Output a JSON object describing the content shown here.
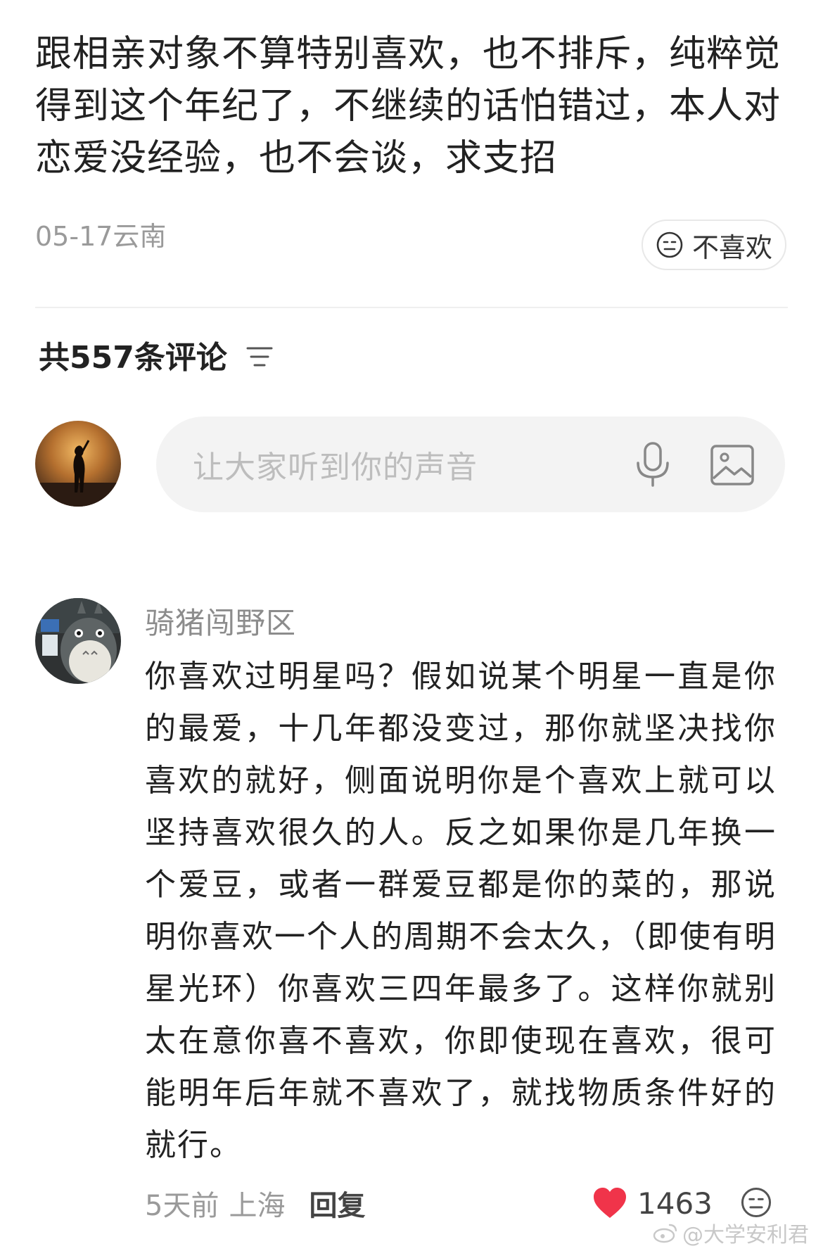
{
  "post": {
    "text": "跟相亲对象不算特别喜欢，也不排斥，纯粹觉得到这个年纪了，不继续的话怕错过，本人对恋爱没经验，也不会谈，求支招",
    "meta": "05-17云南",
    "dislike_label": "不喜欢"
  },
  "comments_section": {
    "header": "共557条评论",
    "input_placeholder": "让大家听到你的声音"
  },
  "comment": {
    "author": "骑猪闯野区",
    "body": "你喜欢过明星吗？假如说某个明星一直是你的最爱，十几年都没变过，那你就坚决找你喜欢的就好，侧面说明你是个喜欢上就可以坚持喜欢很久的人。反之如果你是几年换一个爱豆，或者一群爱豆都是你的菜的，那说明你喜欢一个人的周期不会太久，（即使有明星光环）你喜欢三四年最多了。这样你就别太在意你喜不喜欢，你即使现在喜欢，很可能明年后年就不喜欢了，就找物质条件好的就行。",
    "time": "5天前",
    "location": "上海",
    "reply_label": "回复",
    "like_count": "1463"
  },
  "watermark": {
    "text": "@大学安利君"
  },
  "icons": {
    "dislike": "neutral-face-icon",
    "sort": "sort-lines-icon",
    "mic": "microphone-icon",
    "image": "image-icon",
    "heart": "heart-icon",
    "weibo": "weibo-icon"
  },
  "colors": {
    "heart": "#f0344a",
    "muted_text": "#9a9a9a",
    "input_bg": "#f3f3f3"
  }
}
